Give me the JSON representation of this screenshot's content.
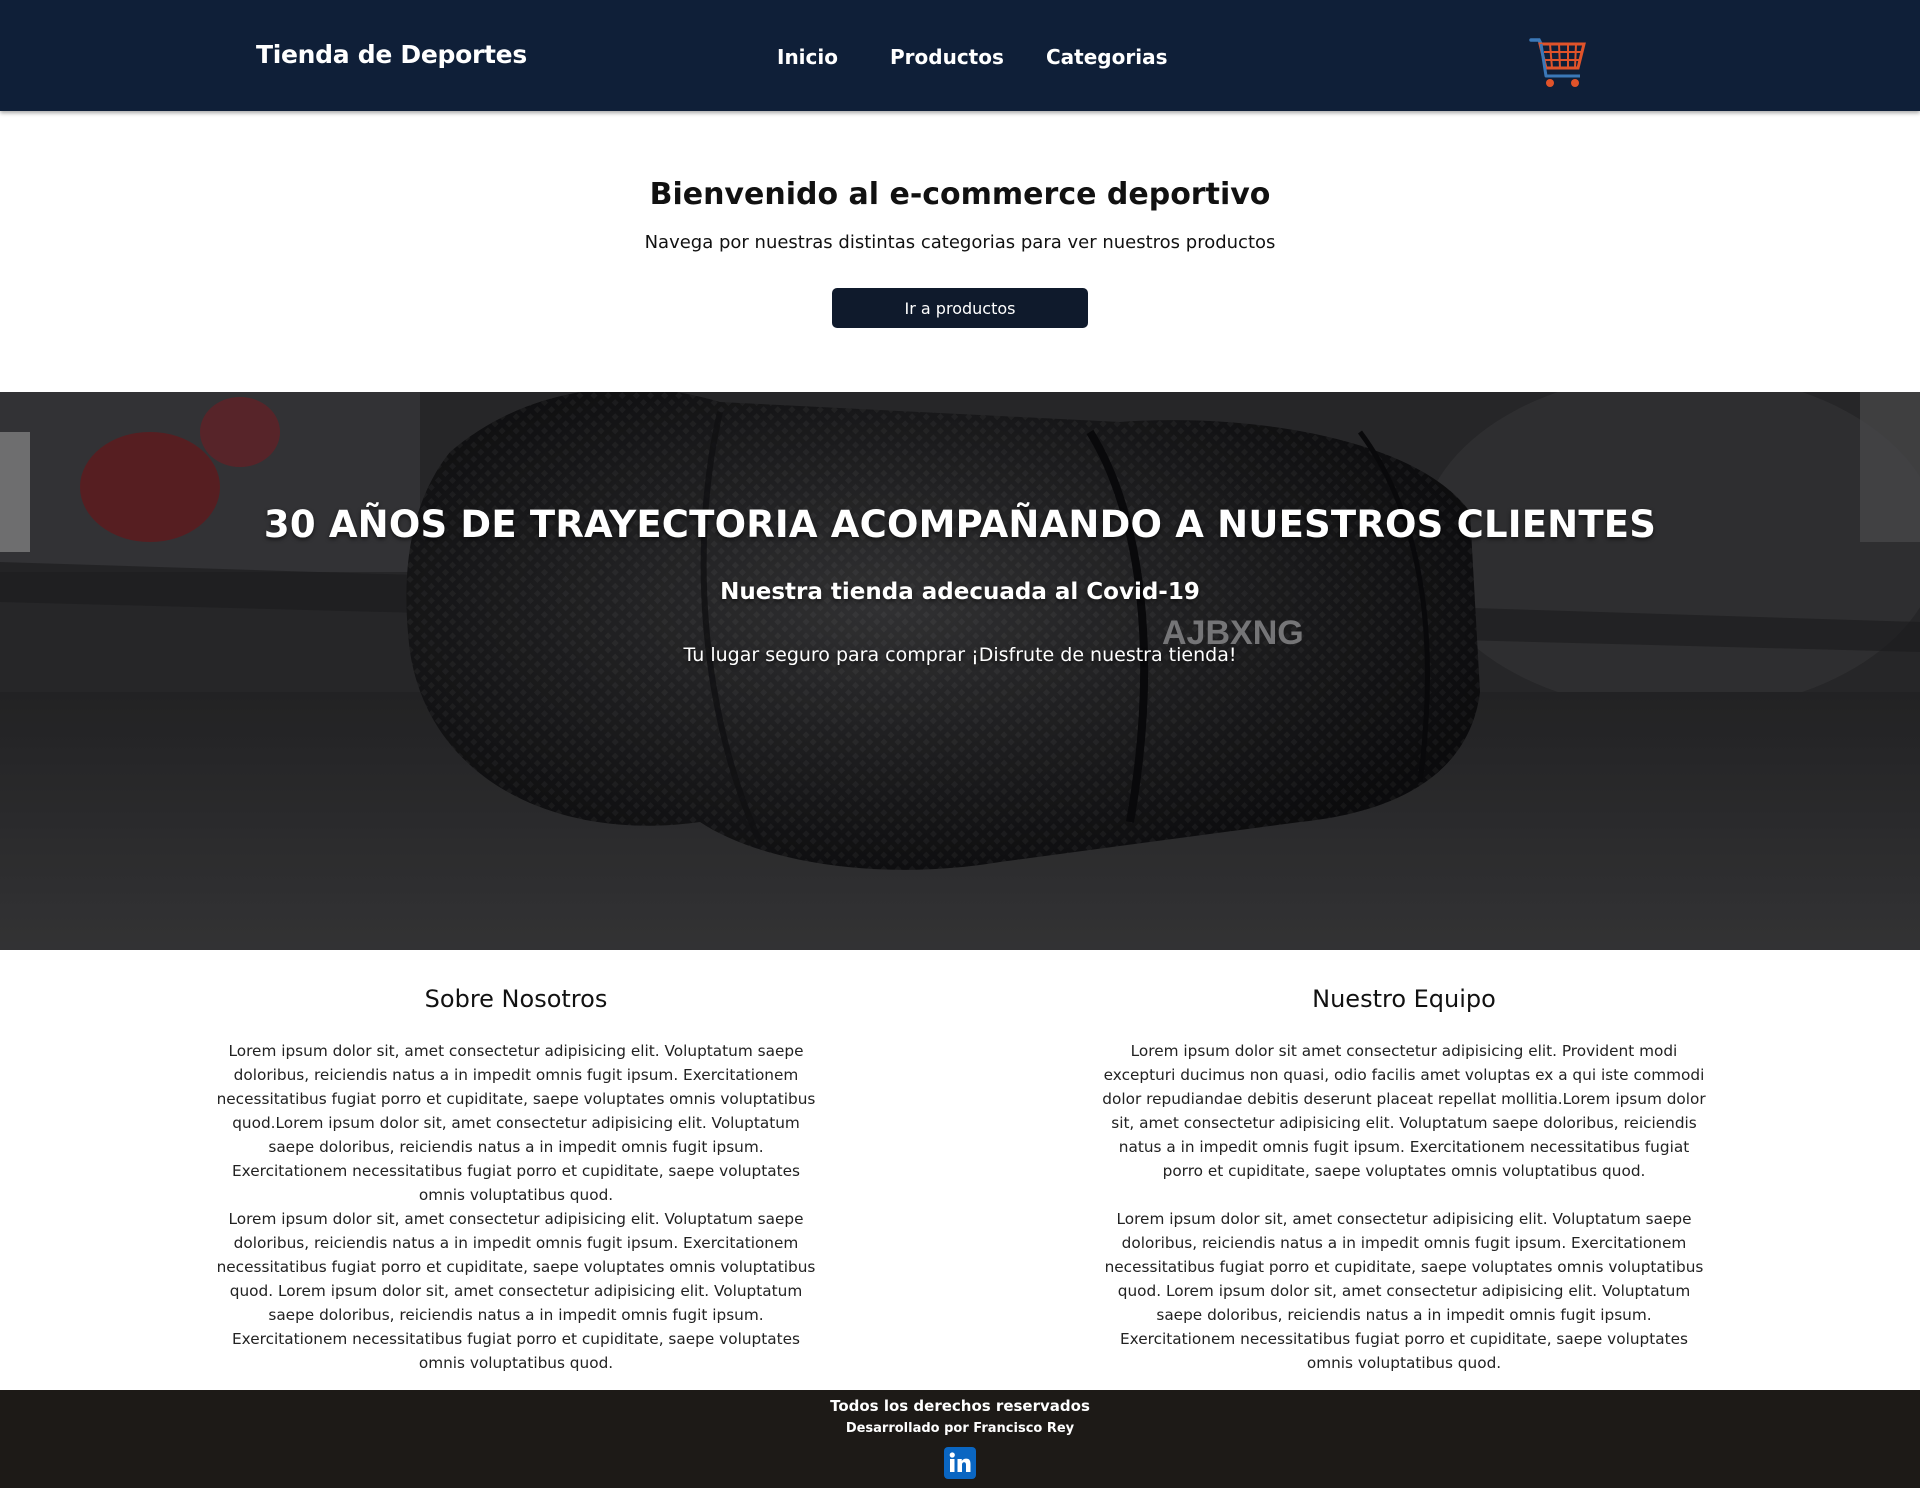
{
  "navbar": {
    "brand": "Tienda de Deportes",
    "links": [
      "Inicio",
      "Productos",
      "Categorias"
    ],
    "cart_icon": "shopping-cart-icon",
    "background": "#0f1f38"
  },
  "welcome": {
    "title": "Bienvenido al e-commerce deportivo",
    "subtitle": "Navega por nuestras distintas categorias para ver nuestros productos",
    "button_label": "Ir a productos"
  },
  "hero": {
    "title": "30 AÑOS DE TRAYECTORIA ACOMPAÑANDO A NUESTROS CLIENTES",
    "subtitle": "Nuestra tienda adecuada al Covid-19",
    "text": "Tu lugar seguro para comprar ¡Disfrute de nuestra tienda!",
    "image_brand_text": "AJBXNG"
  },
  "about": {
    "left": {
      "title": "Sobre Nosotros",
      "paragraph1": "Lorem ipsum dolor sit, amet consectetur adipisicing elit. Voluptatum saepe doloribus, reiciendis natus a in impedit omnis fugit ipsum. Exercitationem necessitatibus fugiat porro et cupiditate, saepe voluptates omnis voluptatibus quod.Lorem ipsum dolor sit, amet consectetur adipisicing elit. Voluptatum saepe doloribus, reiciendis natus a in impedit omnis fugit ipsum. Exercitationem necessitatibus fugiat porro et cupiditate, saepe voluptates omnis voluptatibus quod.",
      "paragraph2": "Lorem ipsum dolor sit, amet consectetur adipisicing elit. Voluptatum saepe doloribus, reiciendis natus a in impedit omnis fugit ipsum. Exercitationem necessitatibus fugiat porro et cupiditate, saepe voluptates omnis voluptatibus quod. Lorem ipsum dolor sit, amet consectetur adipisicing elit. Voluptatum saepe doloribus, reiciendis natus a in impedit omnis fugit ipsum. Exercitationem necessitatibus fugiat porro et cupiditate, saepe voluptates omnis voluptatibus quod."
    },
    "right": {
      "title": "Nuestro Equipo",
      "paragraph1": "Lorem ipsum dolor sit amet consectetur adipisicing elit. Provident modi excepturi ducimus non quasi, odio facilis amet voluptas ex a qui iste commodi dolor repudiandae debitis deserunt placeat repellat mollitia.Lorem ipsum dolor sit, amet consectetur adipisicing elit. Voluptatum saepe doloribus, reiciendis natus a in impedit omnis fugit ipsum. Exercitationem necessitatibus fugiat porro et cupiditate, saepe voluptates omnis voluptatibus quod.",
      "paragraph2": "Lorem ipsum dolor sit, amet consectetur adipisicing elit. Voluptatum saepe doloribus, reiciendis natus a in impedit omnis fugit ipsum. Exercitationem necessitatibus fugiat porro et cupiditate, saepe voluptates omnis voluptatibus quod. Lorem ipsum dolor sit, amet consectetur adipisicing elit. Voluptatum saepe doloribus, reiciendis natus a in impedit omnis fugit ipsum. Exercitationem necessitatibus fugiat porro et cupiditate, saepe voluptates omnis voluptatibus quod."
    }
  },
  "footer": {
    "rights": "Todos los derechos reservados",
    "developer": "Desarrollado por Francisco Rey",
    "social_icon": "linkedin-icon",
    "background": "#1d1a17"
  },
  "colors": {
    "button": "#0f1a2c",
    "cart_accent": "#e0532a",
    "linkedin": "#0a66c2"
  }
}
